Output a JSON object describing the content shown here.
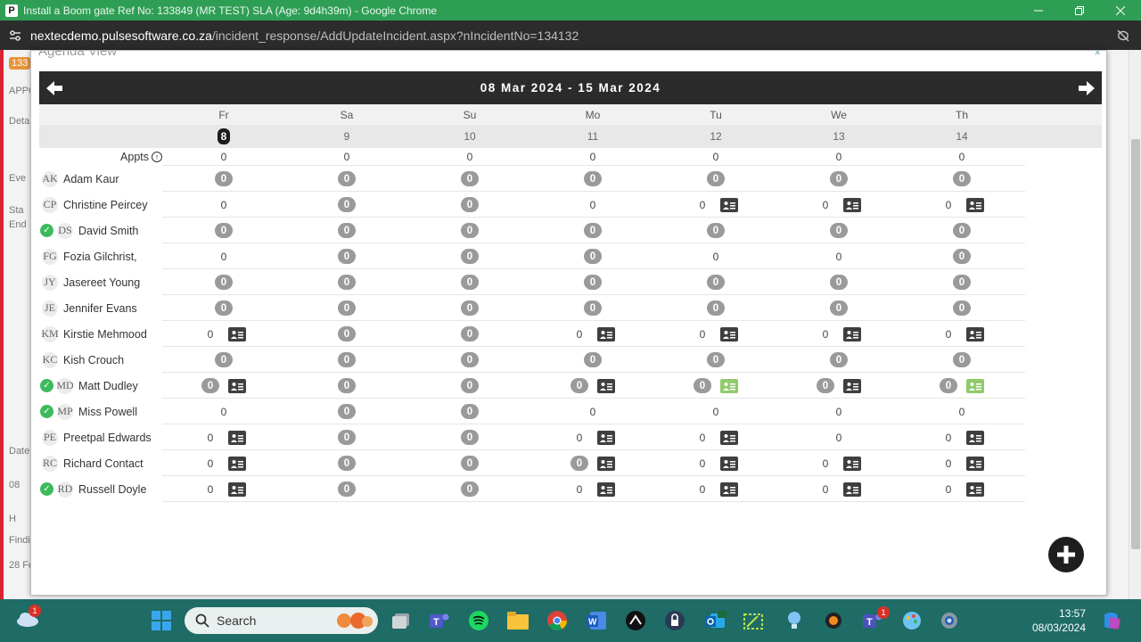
{
  "window": {
    "title": "Install a Boom gate Ref No: 133849 (MR TEST) SLA (Age: 9d4h39m) - Google Chrome",
    "app_icon_letter": "P"
  },
  "address": {
    "host": "nextecdemo.pulsesoftware.co.za",
    "path": "/incident_response/AddUpdateIncident.aspx?nIncidentNo=134132"
  },
  "background": {
    "badge": "133",
    "hints": [
      "APPO",
      "Deta",
      "Eve",
      "Sta",
      "End",
      "Date",
      "08",
      "H",
      "Findi",
      "28 Fe"
    ]
  },
  "modal": {
    "title": "Agenda View",
    "close": "×"
  },
  "calendar": {
    "range": "08 Mar 2024 - 15 Mar 2024",
    "days": [
      "Fr",
      "Sa",
      "Su",
      "Mo",
      "Tu",
      "We",
      "Th"
    ],
    "dates": [
      "8",
      "9",
      "10",
      "11",
      "12",
      "13",
      "14"
    ],
    "today_index": 0,
    "appts_label": "Appts",
    "appts_values": [
      "0",
      "0",
      "0",
      "0",
      "0",
      "0",
      "0"
    ]
  },
  "staff": [
    {
      "initials": "AK",
      "name": "Adam Kaur",
      "checked": false,
      "cells": [
        {
          "v": "0",
          "pill": true
        },
        {
          "v": "0",
          "pill": true
        },
        {
          "v": "0",
          "pill": true
        },
        {
          "v": "0",
          "pill": true
        },
        {
          "v": "0",
          "pill": true
        },
        {
          "v": "0",
          "pill": true
        },
        {
          "v": "0",
          "pill": true
        }
      ]
    },
    {
      "initials": "CP",
      "name": "Christine Peircey",
      "checked": false,
      "cells": [
        {
          "v": "0"
        },
        {
          "v": "0",
          "pill": true
        },
        {
          "v": "0",
          "pill": true
        },
        {
          "v": "0"
        },
        {
          "v": "0",
          "card": "dark"
        },
        {
          "v": "0",
          "card": "dark"
        },
        {
          "v": "0",
          "card": "dark"
        }
      ]
    },
    {
      "initials": "DS",
      "name": "David Smith",
      "checked": true,
      "cells": [
        {
          "v": "0",
          "pill": true
        },
        {
          "v": "0",
          "pill": true
        },
        {
          "v": "0",
          "pill": true
        },
        {
          "v": "0",
          "pill": true
        },
        {
          "v": "0",
          "pill": true
        },
        {
          "v": "0",
          "pill": true
        },
        {
          "v": "0",
          "pill": true
        }
      ]
    },
    {
      "initials": "FG",
      "name": "Fozia Gilchrist,",
      "checked": false,
      "cells": [
        {
          "v": "0"
        },
        {
          "v": "0",
          "pill": true
        },
        {
          "v": "0",
          "pill": true
        },
        {
          "v": "0",
          "pill": true
        },
        {
          "v": "0"
        },
        {
          "v": "0"
        },
        {
          "v": "0",
          "pill": true
        }
      ]
    },
    {
      "initials": "JY",
      "name": "Jasereet Young",
      "checked": false,
      "cells": [
        {
          "v": "0",
          "pill": true
        },
        {
          "v": "0",
          "pill": true
        },
        {
          "v": "0",
          "pill": true
        },
        {
          "v": "0",
          "pill": true
        },
        {
          "v": "0",
          "pill": true
        },
        {
          "v": "0",
          "pill": true
        },
        {
          "v": "0",
          "pill": true
        }
      ]
    },
    {
      "initials": "JE",
      "name": "Jennifer Evans",
      "checked": false,
      "cells": [
        {
          "v": "0",
          "pill": true
        },
        {
          "v": "0",
          "pill": true
        },
        {
          "v": "0",
          "pill": true
        },
        {
          "v": "0",
          "pill": true
        },
        {
          "v": "0",
          "pill": true
        },
        {
          "v": "0",
          "pill": true
        },
        {
          "v": "0",
          "pill": true
        }
      ]
    },
    {
      "initials": "KM",
      "name": "Kirstie Mehmood",
      "checked": false,
      "cells": [
        {
          "v": "0",
          "card": "dark"
        },
        {
          "v": "0",
          "pill": true
        },
        {
          "v": "0",
          "pill": true
        },
        {
          "v": "0",
          "card": "dark"
        },
        {
          "v": "0",
          "card": "dark"
        },
        {
          "v": "0",
          "card": "dark"
        },
        {
          "v": "0",
          "card": "dark"
        }
      ]
    },
    {
      "initials": "KC",
      "name": "Kish Crouch",
      "checked": false,
      "cells": [
        {
          "v": "0",
          "pill": true
        },
        {
          "v": "0",
          "pill": true
        },
        {
          "v": "0",
          "pill": true
        },
        {
          "v": "0",
          "pill": true
        },
        {
          "v": "0",
          "pill": true
        },
        {
          "v": "0",
          "pill": true
        },
        {
          "v": "0",
          "pill": true
        }
      ]
    },
    {
      "initials": "MD",
      "name": "Matt Dudley",
      "checked": true,
      "cells": [
        {
          "v": "0",
          "pill": true,
          "card": "dark"
        },
        {
          "v": "0",
          "pill": true
        },
        {
          "v": "0",
          "pill": true
        },
        {
          "v": "0",
          "pill": true,
          "card": "dark"
        },
        {
          "v": "0",
          "pill": true,
          "card": "green"
        },
        {
          "v": "0",
          "pill": true,
          "card": "dark"
        },
        {
          "v": "0",
          "pill": true,
          "card": "green"
        }
      ]
    },
    {
      "initials": "MP",
      "name": "Miss Powell",
      "checked": true,
      "cells": [
        {
          "v": "0"
        },
        {
          "v": "0",
          "pill": true
        },
        {
          "v": "0",
          "pill": true
        },
        {
          "v": "0"
        },
        {
          "v": "0"
        },
        {
          "v": "0"
        },
        {
          "v": "0"
        }
      ]
    },
    {
      "initials": "PE",
      "name": "Preetpal Edwards",
      "checked": false,
      "cells": [
        {
          "v": "0",
          "card": "dark"
        },
        {
          "v": "0",
          "pill": true
        },
        {
          "v": "0",
          "pill": true
        },
        {
          "v": "0",
          "card": "dark"
        },
        {
          "v": "0",
          "card": "dark"
        },
        {
          "v": "0"
        },
        {
          "v": "0",
          "card": "dark"
        }
      ]
    },
    {
      "initials": "RC",
      "name": "Richard Contact",
      "checked": false,
      "cells": [
        {
          "v": "0",
          "card": "dark"
        },
        {
          "v": "0",
          "pill": true
        },
        {
          "v": "0",
          "pill": true
        },
        {
          "v": "0",
          "pill": true,
          "card": "dark"
        },
        {
          "v": "0",
          "card": "dark"
        },
        {
          "v": "0",
          "card": "dark"
        },
        {
          "v": "0",
          "card": "dark"
        }
      ]
    },
    {
      "initials": "RD",
      "name": "Russell Doyle",
      "checked": true,
      "cells": [
        {
          "v": "0",
          "card": "dark"
        },
        {
          "v": "0",
          "pill": true
        },
        {
          "v": "0",
          "pill": true
        },
        {
          "v": "0",
          "card": "dark"
        },
        {
          "v": "0",
          "card": "dark"
        },
        {
          "v": "0",
          "card": "dark"
        },
        {
          "v": "0",
          "card": "dark"
        }
      ]
    }
  ],
  "taskbar": {
    "search_label": "Search",
    "time": "13:57",
    "date": "08/03/2024",
    "cloud_badge": "1",
    "teams_badge": "1"
  },
  "colors": {
    "titlebar": "#2f9e55",
    "header": "#2b2b2b",
    "pill": "#9a9a9a",
    "check": "#3dbb5c",
    "card_green": "#8fcb6b",
    "taskbar": "#1f6b66"
  }
}
